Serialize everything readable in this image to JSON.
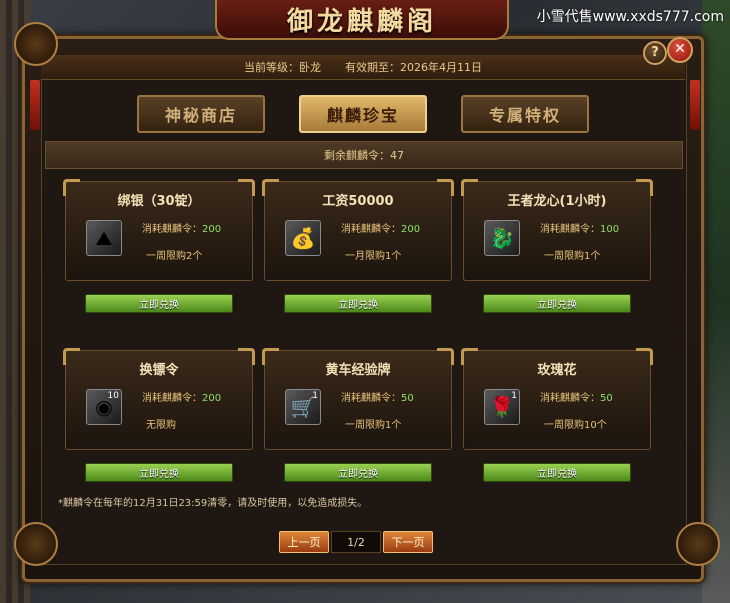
{
  "watermark": "小雪代售www.xxds777.com",
  "window": {
    "title": "御龙麒麟阁"
  },
  "header": {
    "level": "当前等级：卧龙",
    "expiry": "有效期至：2026年4月11日"
  },
  "tabs": [
    {
      "label": "神秘商店",
      "active": false
    },
    {
      "label": "麒麟珍宝",
      "active": true
    },
    {
      "label": "专属特权",
      "active": false
    }
  ],
  "remaining": "剩余麒麟令：47",
  "cost_label": "消耗麒麟令：",
  "exchange_label": "立即兑换",
  "items": [
    {
      "name": "绑银（30锭）",
      "cost": "200",
      "limit": "一周限购2个",
      "icon": "silver-ingot-icon",
      "glyph": "⛰",
      "count": ""
    },
    {
      "name": "工资50000",
      "cost": "200",
      "limit": "一月限购1个",
      "icon": "gold-bag-icon",
      "glyph": "💰",
      "count": ""
    },
    {
      "name": "王者龙心(1小时)",
      "cost": "100",
      "limit": "一周限购1个",
      "icon": "dragon-heart-icon",
      "glyph": "🐉",
      "count": ""
    },
    {
      "name": "换镖令",
      "cost": "200",
      "limit": "无限购",
      "icon": "escort-token-icon",
      "glyph": "◉",
      "count": "10"
    },
    {
      "name": "黄车经验牌",
      "cost": "50",
      "limit": "一周限购1个",
      "icon": "cart-card-icon",
      "glyph": "🛒",
      "count": "1"
    },
    {
      "name": "玫瑰花",
      "cost": "50",
      "limit": "一周限购10个",
      "icon": "rose-icon",
      "glyph": "🌹",
      "count": "1"
    }
  ],
  "note": "*麒麟令在每年的12月31日23:59清零，请及时使用，以免造成损失。",
  "pager": {
    "prev": "上一页",
    "page": "1/2",
    "next": "下一页"
  },
  "buttons": {
    "help": "?",
    "close": "✕"
  },
  "colors": {
    "accent": "#c49a50",
    "cost_value": "#8fe070",
    "exchange_button": "#6aa832"
  }
}
